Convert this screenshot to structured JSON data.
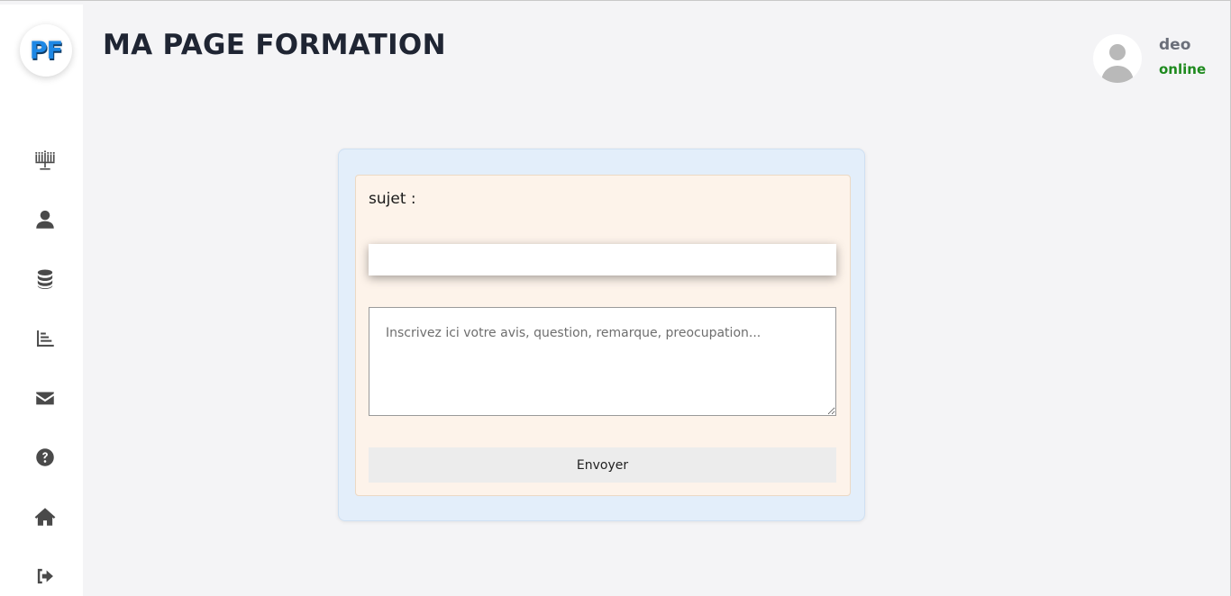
{
  "brand": {
    "logo_text": "PF"
  },
  "header": {
    "title": "MA PAGE FORMATION"
  },
  "user": {
    "name": "deo",
    "status": "online"
  },
  "sidebar": {
    "items": [
      {
        "icon": "menorah-icon"
      },
      {
        "icon": "user-icon"
      },
      {
        "icon": "database-icon"
      },
      {
        "icon": "chart-bar-icon"
      },
      {
        "icon": "envelope-icon"
      },
      {
        "icon": "question-circle-icon"
      },
      {
        "icon": "home-icon"
      },
      {
        "icon": "sign-out-icon"
      }
    ]
  },
  "form": {
    "subject_label": "sujet :",
    "subject_value": "",
    "message_placeholder": "Inscrivez ici votre avis, question, remarque, preocupation...",
    "submit_label": "Envoyer"
  },
  "colors": {
    "status_online": "#1e8a1e",
    "card_outer": "#e3eefa",
    "card_inner": "#fdf3ea",
    "logo": "#1e88e5"
  }
}
